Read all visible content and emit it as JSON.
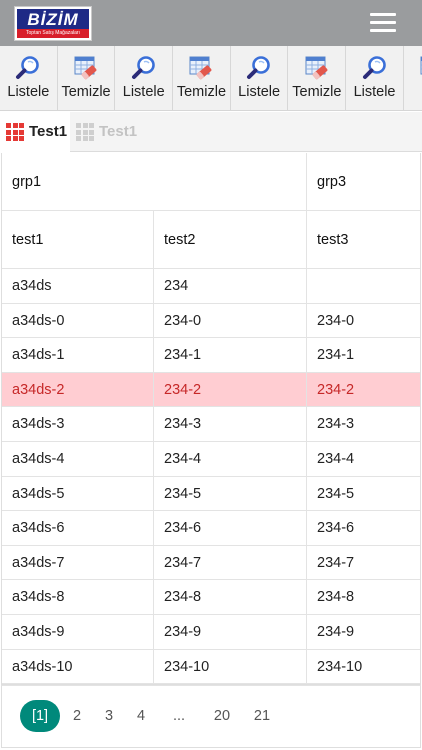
{
  "brand": {
    "logo_text": "BİZİM",
    "logo_sub": "Toptan Satış Mağazaları",
    "primary": "#1e2a86",
    "accent": "#d81e2a"
  },
  "toolbar": {
    "items": [
      {
        "label": "Listele",
        "icon": "search-icon"
      },
      {
        "label": "Temizle",
        "icon": "clear-table-icon"
      },
      {
        "label": "Listele",
        "icon": "search-icon"
      },
      {
        "label": "Temizle",
        "icon": "clear-table-icon"
      },
      {
        "label": "Listele",
        "icon": "search-icon"
      },
      {
        "label": "Temizle",
        "icon": "clear-table-icon"
      },
      {
        "label": "Listele",
        "icon": "search-icon"
      },
      {
        "label": "Te",
        "icon": "clear-table-icon"
      }
    ]
  },
  "tabs": [
    {
      "label": "Test1",
      "active": true
    },
    {
      "label": "Test1",
      "active": false
    }
  ],
  "table": {
    "groups": [
      "grp1",
      "grp3"
    ],
    "columns": [
      "test1",
      "test2",
      "test3"
    ],
    "rows": [
      [
        "a34ds",
        "234",
        ""
      ],
      [
        "a34ds-0",
        "234-0",
        "234-0"
      ],
      [
        "a34ds-1",
        "234-1",
        "234-1"
      ],
      [
        "a34ds-2",
        "234-2",
        "234-2"
      ],
      [
        "a34ds-3",
        "234-3",
        "234-3"
      ],
      [
        "a34ds-4",
        "234-4",
        "234-4"
      ],
      [
        "a34ds-5",
        "234-5",
        "234-5"
      ],
      [
        "a34ds-6",
        "234-6",
        "234-6"
      ],
      [
        "a34ds-7",
        "234-7",
        "234-7"
      ],
      [
        "a34ds-8",
        "234-8",
        "234-8"
      ],
      [
        "a34ds-9",
        "234-9",
        "234-9"
      ],
      [
        "a34ds-10",
        "234-10",
        "234-10"
      ]
    ],
    "selected_row_index": 3,
    "selected_color": "#ffcdd2"
  },
  "pager": {
    "pages": [
      "[1]",
      "2",
      "3",
      "4",
      "...",
      "20",
      "21"
    ],
    "active_index": 0,
    "active_color": "#00897b"
  }
}
